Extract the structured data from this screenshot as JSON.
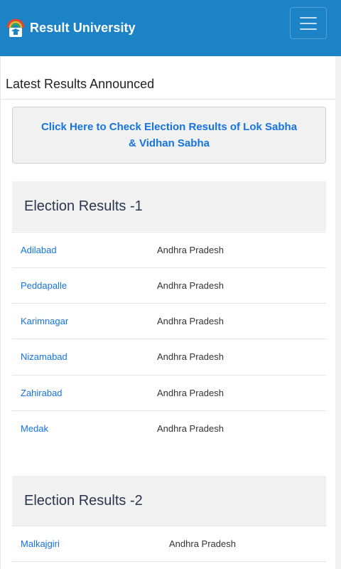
{
  "header": {
    "brand": "Result University",
    "logo_icon": "graduation-cap-icon",
    "menu_icon": "hamburger-menu-icon"
  },
  "main": {
    "section_title": "Latest Results Announced",
    "check_button_label": "Click Here to Check Election Results of Lok Sabha & Vidhan Sabha",
    "groups": [
      {
        "title": "Election Results -1",
        "rows": [
          {
            "constituency": "Adilabad",
            "state": "Andhra Pradesh"
          },
          {
            "constituency": "Peddapalle",
            "state": "Andhra Pradesh"
          },
          {
            "constituency": "Karimnagar",
            "state": "Andhra Pradesh"
          },
          {
            "constituency": "Nizamabad",
            "state": "Andhra Pradesh"
          },
          {
            "constituency": "Zahirabad",
            "state": "Andhra Pradesh"
          },
          {
            "constituency": "Medak",
            "state": "Andhra Pradesh"
          }
        ]
      },
      {
        "title": "Election Results -2",
        "rows": [
          {
            "constituency": "Malkajgiri",
            "state": "Andhra Pradesh"
          }
        ]
      }
    ]
  },
  "colors": {
    "navbar": "#1b83c6",
    "link": "#1474e0",
    "group_header_bg": "#f1f1f1"
  }
}
